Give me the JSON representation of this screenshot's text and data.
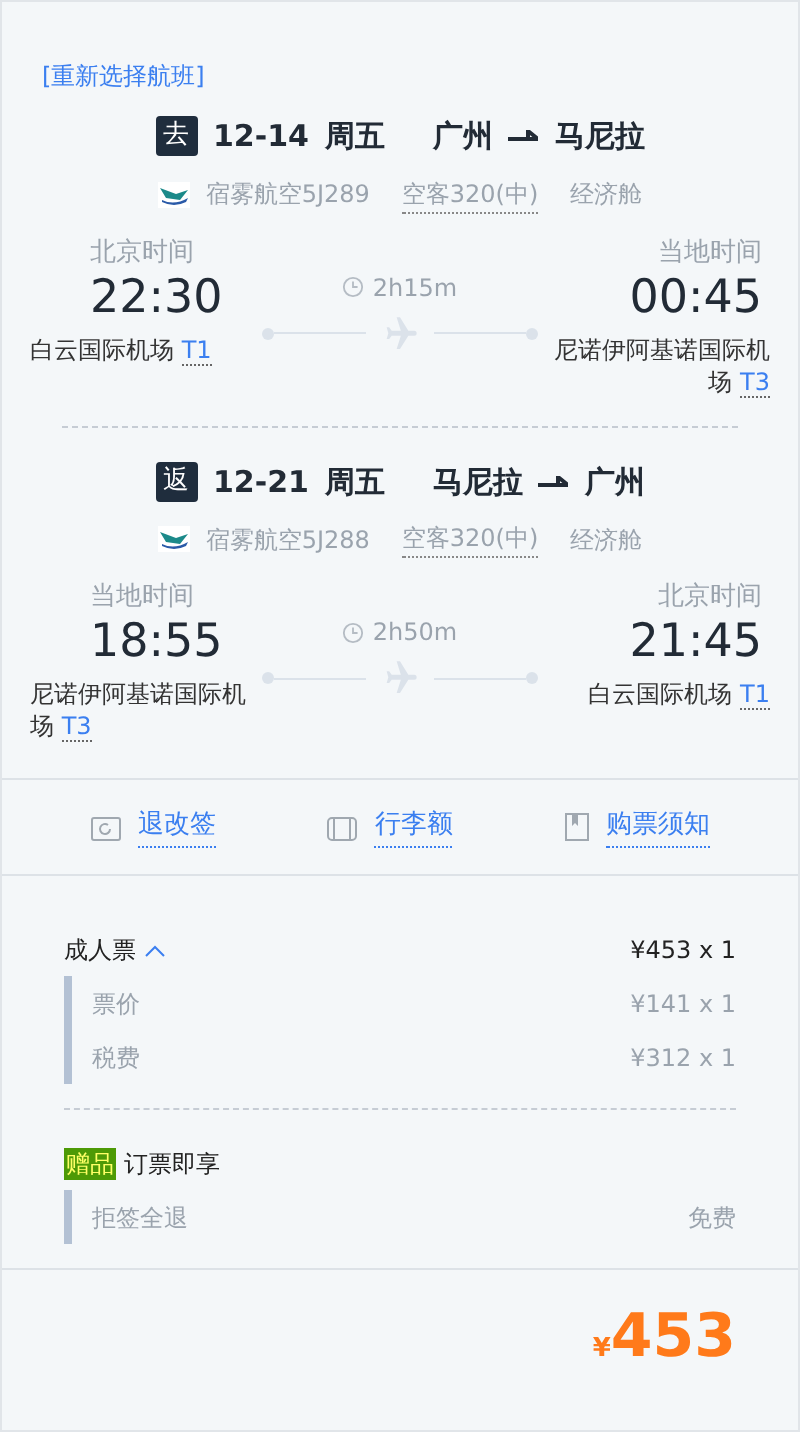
{
  "reselect_link": "[重新选择航班]",
  "flights": [
    {
      "badge": "去",
      "date": "12-14",
      "weekday": "周五",
      "from": "广州",
      "to": "马尼拉",
      "airline": "宿雾航空5J289",
      "aircraft": "空客320(中)",
      "cabin": "经济舱",
      "duration": "2h15m",
      "departure": {
        "zone": "北京时间",
        "time": "22:30",
        "airport": "白云国际机场",
        "terminal": "T1"
      },
      "arrival": {
        "zone": "当地时间",
        "time": "00:45",
        "airport": "尼诺伊阿基诺国际机场",
        "terminal": "T3"
      }
    },
    {
      "badge": "返",
      "date": "12-21",
      "weekday": "周五",
      "from": "马尼拉",
      "to": "广州",
      "airline": "宿雾航空5J288",
      "aircraft": "空客320(中)",
      "cabin": "经济舱",
      "duration": "2h50m",
      "departure": {
        "zone": "当地时间",
        "time": "18:55",
        "airport": "尼诺伊阿基诺国际机场",
        "terminal": "T3"
      },
      "arrival": {
        "zone": "北京时间",
        "time": "21:45",
        "airport": "白云国际机场",
        "terminal": "T1"
      }
    }
  ],
  "links": [
    {
      "kind": "refund",
      "label": "退改签"
    },
    {
      "kind": "baggage",
      "label": "行李额"
    },
    {
      "kind": "notice",
      "label": "购票须知"
    }
  ],
  "ticket": {
    "label": "成人票",
    "expanded": true,
    "price": "¥453 x 1",
    "items": [
      {
        "label": "票价",
        "price": "¥141 x 1"
      },
      {
        "label": "税费",
        "price": "¥312 x 1"
      }
    ]
  },
  "gift": {
    "badge": "赠品",
    "title": "订票即享",
    "items": [
      {
        "label": "拒签全退",
        "price": "免费"
      }
    ]
  },
  "total": {
    "currency": "¥",
    "amount": "453"
  }
}
